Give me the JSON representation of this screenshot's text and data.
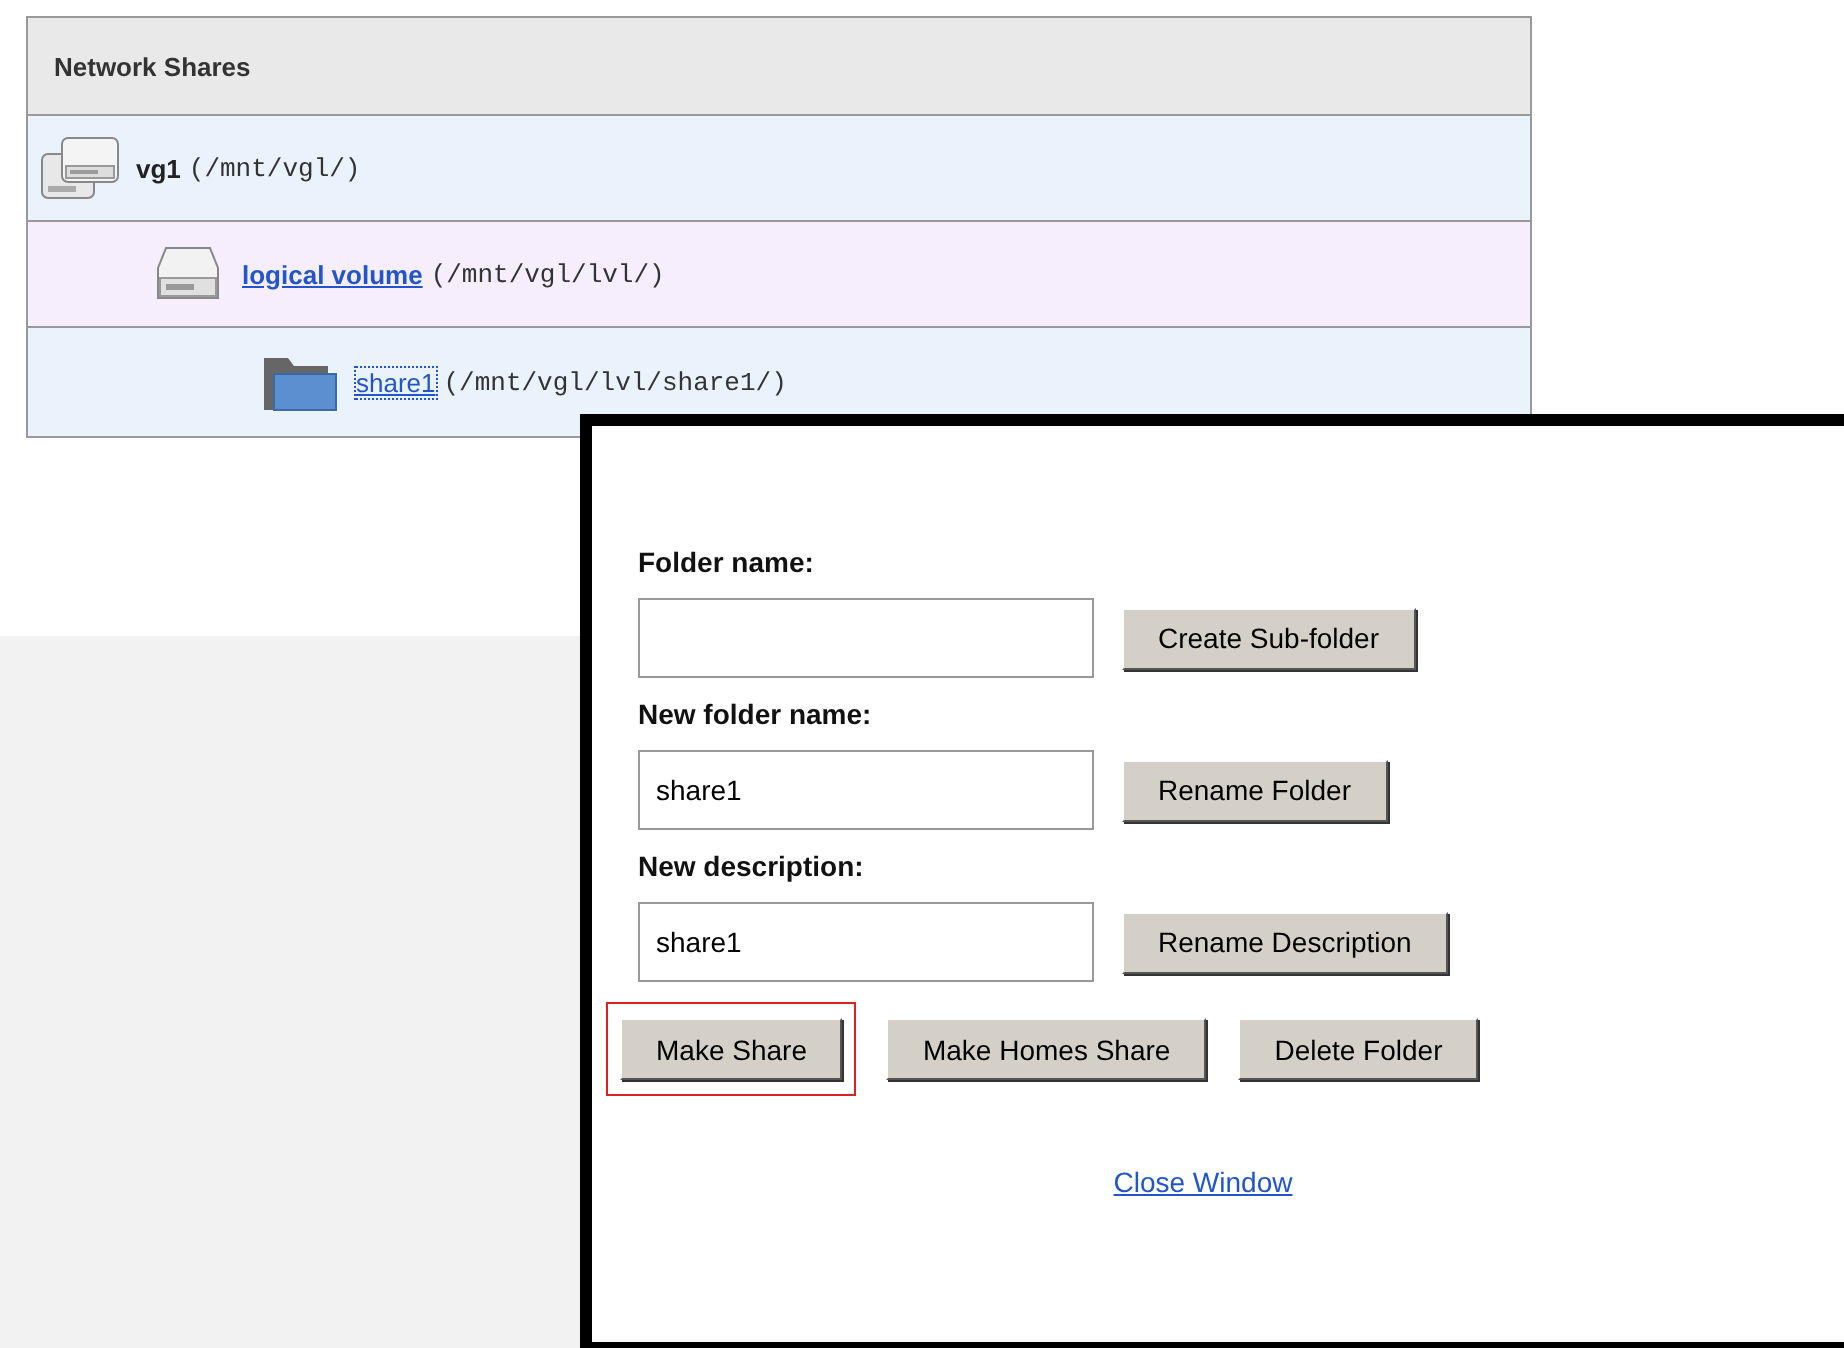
{
  "shares_panel": {
    "title": "Network Shares",
    "tree": [
      {
        "kind": "group",
        "name": "vg1",
        "path": "(/mnt/vgl/)",
        "link": false,
        "focused": false,
        "children": [
          {
            "kind": "volume",
            "name": "logical volume",
            "path": "(/mnt/vgl/lvl/)",
            "link": true,
            "focused": false,
            "children": [
              {
                "kind": "folder",
                "name": "share1",
                "path": "(/mnt/vgl/lvl/share1/)",
                "link": true,
                "focused": true
              }
            ]
          }
        ]
      }
    ]
  },
  "folder_dialog": {
    "fields": [
      {
        "label": "Folder name:",
        "button": "Create Sub-folder"
      },
      {
        "label": "New folder name:",
        "value": "share1",
        "button": "Rename Folder"
      },
      {
        "label": "New description:",
        "value": "share1",
        "button": "Rename Description"
      }
    ],
    "actions": [
      {
        "label": "Make Share",
        "highlighted": true
      },
      {
        "label": "Make Homes Share",
        "highlighted": false
      },
      {
        "label": "Delete Folder",
        "highlighted": false
      }
    ],
    "close_link": "Close Window"
  }
}
